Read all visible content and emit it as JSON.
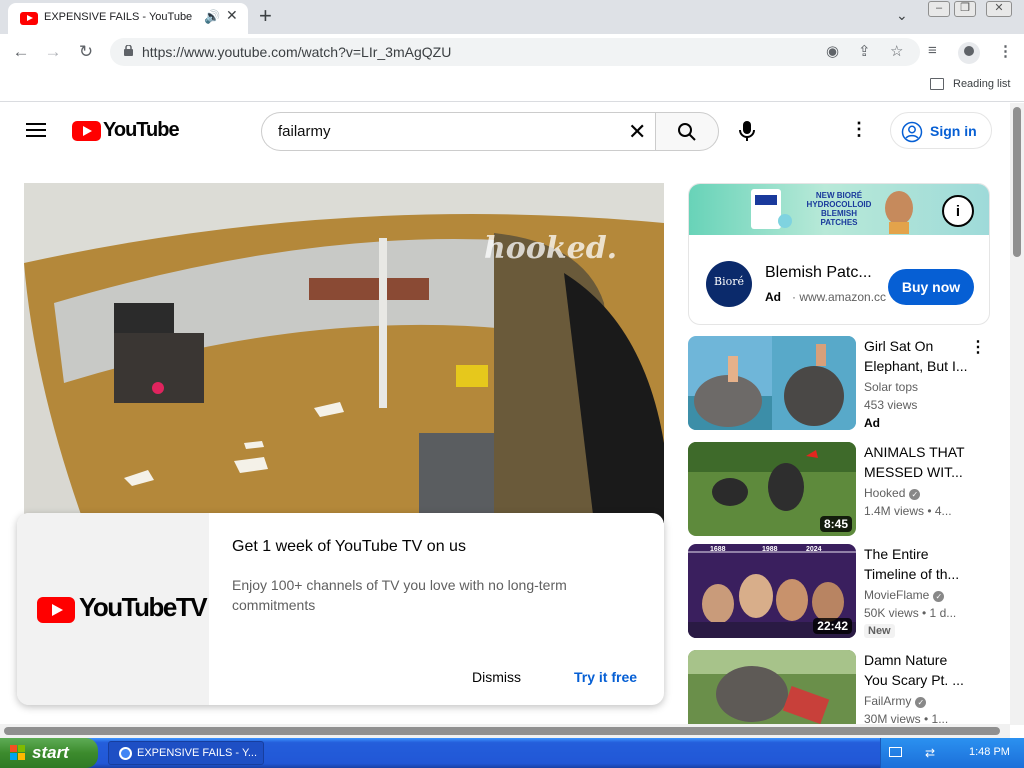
{
  "browser": {
    "tab_title": "EXPENSIVE FAILS - YouTube",
    "url": "https://www.youtube.com/watch?v=LIr_3mAgQZU",
    "reading_list": "Reading list"
  },
  "youtube": {
    "logo_text": "YouTube",
    "search_value": "failarmy",
    "signin_label": "Sign in"
  },
  "player": {
    "watermark": "hooked."
  },
  "promo": {
    "logo_text": "YouTubeTV",
    "title": "Get 1 week of YouTube TV on us",
    "body": "Enjoy 100+ channels of TV you love with no long-term commitments",
    "dismiss": "Dismiss",
    "try_free": "Try it free"
  },
  "ad": {
    "banner_text": "NEW BIORÉ HYDROCOLLOID BLEMISH PATCHES",
    "logo_text": "Bioré",
    "title": "Blemish Patc...",
    "label": "Ad",
    "url": "· www.amazon.cc",
    "buy_label": "Buy now"
  },
  "recommendations": [
    {
      "title": "Girl Sat On Elephant, But I...",
      "channel": "Solar tops",
      "meta": "453 views",
      "badge": "Ad",
      "duration": "",
      "verified": false
    },
    {
      "title": "ANIMALS THAT MESSED WIT...",
      "channel": "Hooked",
      "meta": "1.4M views  • 4...",
      "badge": "",
      "duration": "8:45",
      "verified": true
    },
    {
      "title": "The Entire Timeline of th...",
      "channel": "MovieFlame",
      "meta": "50K views  • 1 d...",
      "badge": "New",
      "duration": "22:42",
      "verified": true
    },
    {
      "title": "Damn Nature You Scary Pt. ...",
      "channel": "FailArmy",
      "meta": "30M views  • 1...",
      "badge": "",
      "duration": "",
      "verified": true
    }
  ],
  "thumb_labels": {
    "timeline_years": [
      "1688",
      "1988",
      "2024"
    ]
  },
  "taskbar": {
    "start_label": "start",
    "task_label": "EXPENSIVE FAILS - Y...",
    "clock": "1:48 PM"
  },
  "colors": {
    "yt_red": "#ff0000",
    "link_blue": "#065fd4",
    "xp_blue": "#245edb",
    "xp_green": "#3c8b2d"
  }
}
